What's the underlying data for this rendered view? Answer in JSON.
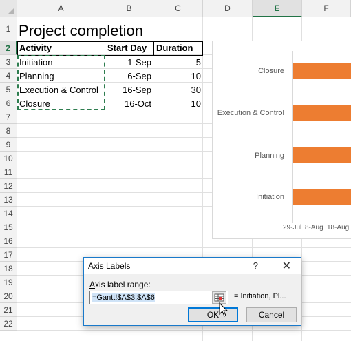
{
  "columns": [
    "A",
    "B",
    "C",
    "D",
    "E",
    "F"
  ],
  "selected_column": "E",
  "rows": [
    "1",
    "2",
    "3",
    "4",
    "5",
    "6",
    "7",
    "8",
    "9",
    "10",
    "11",
    "12",
    "13",
    "14",
    "15",
    "16",
    "17",
    "18",
    "19",
    "20",
    "21",
    "22"
  ],
  "selected_row": "2",
  "sheet": {
    "title": "Project completion",
    "headers": [
      "Activity",
      "Start Day",
      "Duration"
    ],
    "data": [
      [
        "Initiation",
        "1-Sep",
        "5"
      ],
      [
        "Planning",
        "6-Sep",
        "10"
      ],
      [
        "Execution & Control",
        "16-Sep",
        "30"
      ],
      [
        "Closure",
        "16-Oct",
        "10"
      ]
    ]
  },
  "chart": {
    "categories": [
      "Closure",
      "Execution & Control",
      "Planning",
      "Initiation"
    ],
    "x_ticks": [
      "29-Jul",
      "8-Aug",
      "18-Aug"
    ],
    "bar_color": "#ed7d31"
  },
  "dialog": {
    "title": "Axis Labels",
    "help": "?",
    "close": "✕",
    "label": "Axis label range:",
    "input_value": "=Gantt!$A$3:$A$6",
    "preview": "= Initiation, Pl...",
    "ok_label": "OK",
    "cancel_label": "Cancel"
  }
}
